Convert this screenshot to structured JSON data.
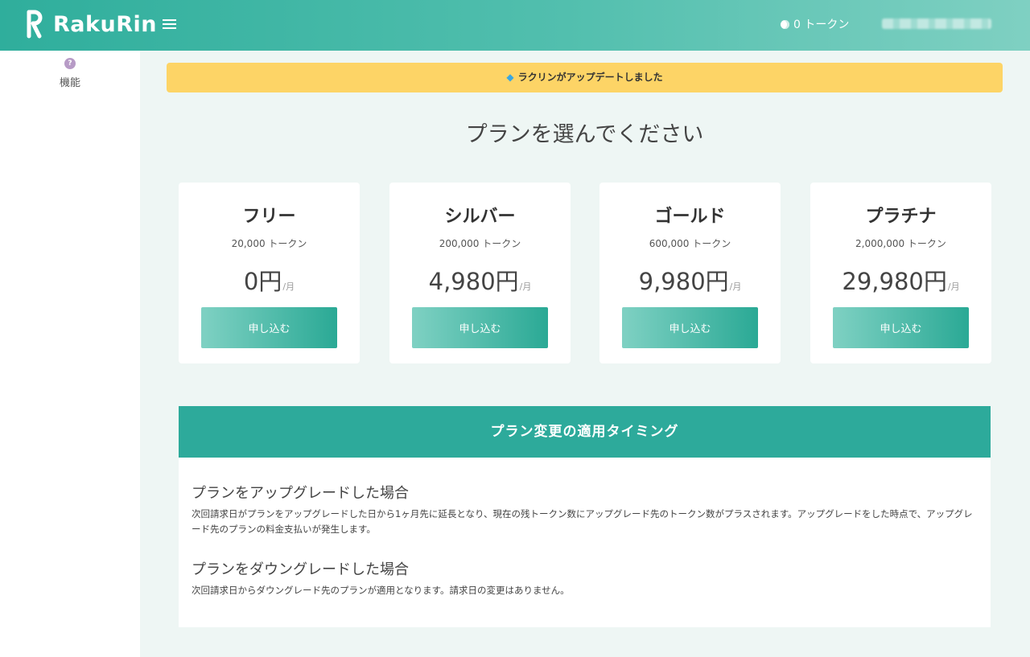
{
  "header": {
    "brand": "RakuRin",
    "token_count": "0 トークン"
  },
  "sidebar": {
    "items": [
      {
        "label": "機能",
        "icon": "help-bubble-icon"
      }
    ]
  },
  "banner": {
    "text": "ラクリンがアップデートしました",
    "icon": "gem-icon"
  },
  "page_title": "プランを選んでください",
  "plans": [
    {
      "name": "フリー",
      "tokens": "20,000 トークン",
      "price": "0円",
      "unit": "/月",
      "button": "申し込む"
    },
    {
      "name": "シルバー",
      "tokens": "200,000 トークン",
      "price": "4,980円",
      "unit": "/月",
      "button": "申し込む"
    },
    {
      "name": "ゴールド",
      "tokens": "600,000 トークン",
      "price": "9,980円",
      "unit": "/月",
      "button": "申し込む"
    },
    {
      "name": "プラチナ",
      "tokens": "2,000,000 トークン",
      "price": "29,980円",
      "unit": "/月",
      "button": "申し込む"
    }
  ],
  "timing": {
    "title": "プラン変更の適用タイミング",
    "upgrade_heading": "プランをアップグレードした場合",
    "upgrade_text": "次回請求日がプランをアップグレードした日から1ヶ月先に延長となり、現在の残トークン数にアップグレード先のトークン数がプラスされます。アップグレードをした時点で、アップグレード先のプランの料金支払いが発生します。",
    "downgrade_heading": "プランをダウングレードした場合",
    "downgrade_text": "次回請求日からダウングレード先のプランが適用となります。請求日の変更はありません。"
  },
  "colors": {
    "header_start": "#2fae9c",
    "header_end": "#7fd0c2",
    "banner": "#fdd466",
    "accent": "#2daa9b"
  }
}
